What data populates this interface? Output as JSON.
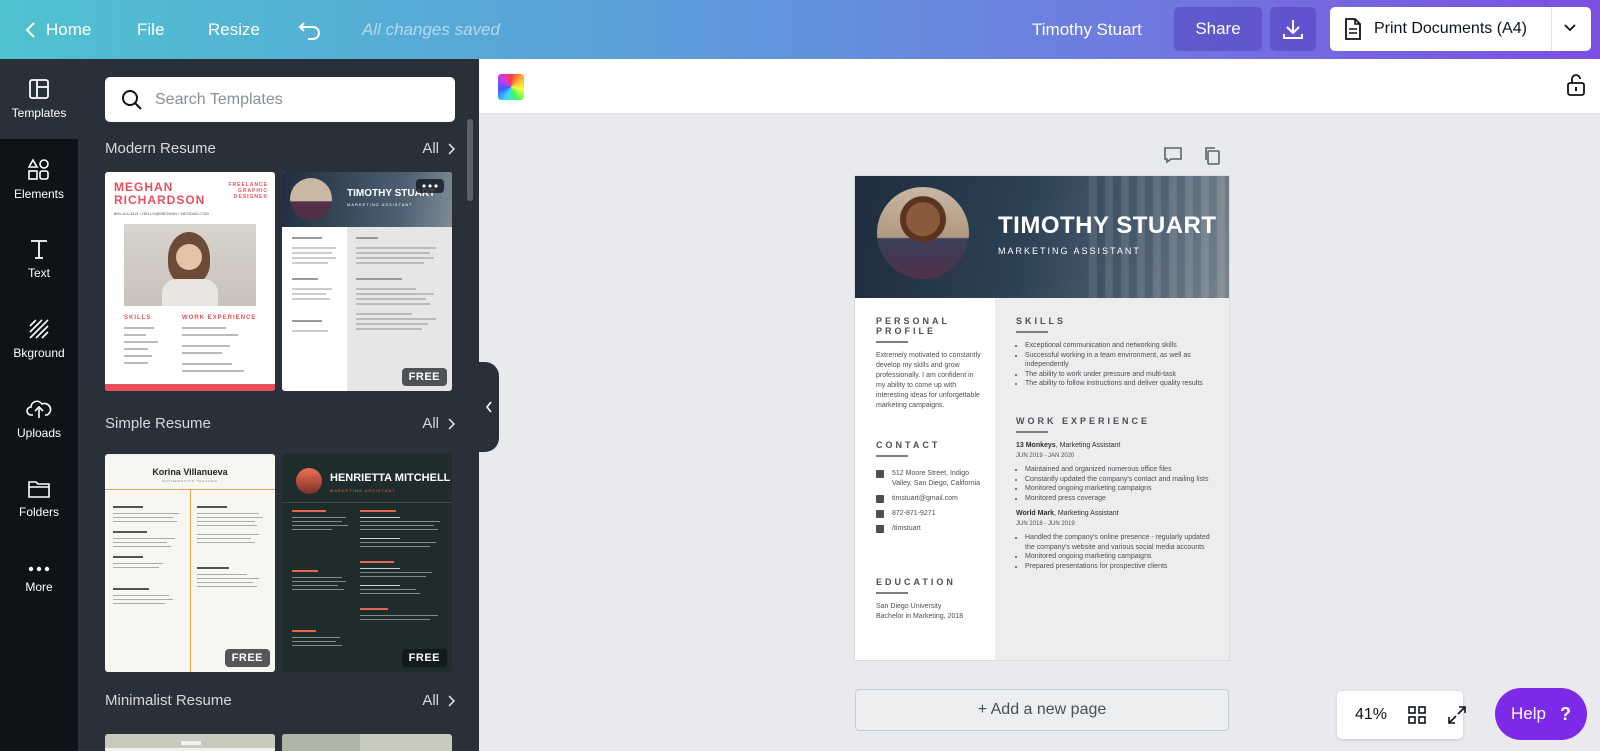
{
  "topbar": {
    "home_label": "Home",
    "file_label": "File",
    "resize_label": "Resize",
    "saved_status": "All changes saved",
    "user_name": "Timothy Stuart",
    "share_label": "Share",
    "print_label": "Print Documents (A4)"
  },
  "rail": {
    "items": [
      {
        "label": "Templates",
        "icon": "templates-icon"
      },
      {
        "label": "Elements",
        "icon": "elements-icon"
      },
      {
        "label": "Text",
        "icon": "text-icon"
      },
      {
        "label": "Bkground",
        "icon": "background-icon"
      },
      {
        "label": "Uploads",
        "icon": "uploads-icon"
      },
      {
        "label": "Folders",
        "icon": "folders-icon"
      },
      {
        "label": "More",
        "icon": "more-icon"
      }
    ]
  },
  "panel": {
    "search_placeholder": "Search Templates",
    "sections": [
      {
        "title": "Modern Resume",
        "all": "All"
      },
      {
        "title": "Simple Resume",
        "all": "All"
      },
      {
        "title": "Minimalist Resume",
        "all": "All"
      }
    ],
    "free_badge": "FREE",
    "thumbs": {
      "meghan_name1": "MEGHAN",
      "meghan_name2": "RICHARDSON",
      "meghan_tag": "FREELANCE GRAPHIC DESIGNER",
      "meghan_contact": "809-124-3421 / HELLO@MEGHAN / WEGDAD.COM",
      "meghan_skills": "SKILLS",
      "meghan_exp": "WORK EXPERIENCE",
      "timothy_name": "TIMOTHY STUART",
      "timothy_role": "MARKETING ASSISTANT",
      "korina_name": "Korina Villanueva",
      "korina_role": "MATHEMATICS TEACHER",
      "henrietta_name": "HENRIETTA MITCHELL",
      "henrietta_role": "MARKETING ASSISTANT"
    }
  },
  "resume": {
    "name": "TIMOTHY STUART",
    "role": "MARKETING ASSISTANT",
    "profile_heading": "PERSONAL PROFILE",
    "profile_text": "Extremely motivated to constantly develop my skills and grow professionally. I am confident in my ability to come up with interesting ideas for unforgettable marketing campaigns.",
    "contact_heading": "CONTACT",
    "contact": {
      "address": "512 Moore Street, Indigo Valley, San Diego, California",
      "email": "timstuart@gmail.com",
      "phone": "872-871-9271",
      "linkedin": "/timstuart"
    },
    "education_heading": "EDUCATION",
    "education_school": "San Diego University",
    "education_degree": "Bachelor in Marketing, 2018",
    "skills_heading": "SKILLS",
    "skills": [
      "Exceptional communication and networking skills",
      "Successful working in a team environment, as well as independently",
      "The ability to work under pressure and multi-task",
      "The ability to follow instructions and deliver quality results"
    ],
    "work_heading": "WORK EXPERIENCE",
    "jobs": [
      {
        "company": "13 Monkeys",
        "title": ", Marketing Assistant",
        "dates": "JUN 2019 - JAN 2020",
        "bullets": [
          "Maintained and organized numerous office files",
          "Constantly updated the company's contact and mailing lists",
          "Monitored ongoing marketing campaigns",
          "Monitored press coverage"
        ]
      },
      {
        "company": "World Mark",
        "title": ", Marketing Assistant",
        "dates": "JUN 2018 - JUN 2019",
        "bullets": [
          "Handled the company's online presence - regularly updated the company's website and various social media accounts",
          "Monitored ongoing marketing campaigns",
          "Prepared presentations for prospective clients"
        ]
      }
    ]
  },
  "add_page_label": "+ Add a new page",
  "zoom_level": "41%",
  "help_label": "Help",
  "help_glyph": "?",
  "colors": {
    "accent": "#7d2ae8",
    "rail_bg": "#0e1318",
    "panel_bg": "#293039",
    "meghan_red": "#e8505b"
  }
}
